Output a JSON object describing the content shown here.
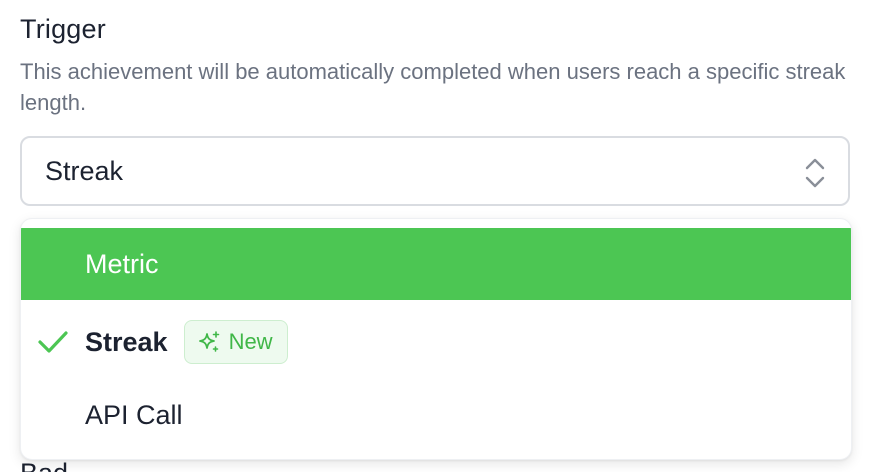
{
  "field": {
    "label": "Trigger",
    "description": "This achievement will be automatically completed when users reach a specific streak length."
  },
  "select": {
    "value": "Streak",
    "icon": "chevron-up-down-icon"
  },
  "dropdown": {
    "options": [
      {
        "label": "Metric",
        "highlighted": true,
        "selected": false
      },
      {
        "label": "Streak",
        "highlighted": false,
        "selected": true,
        "badge": {
          "label": "New",
          "icon": "sparkle-icon"
        }
      },
      {
        "label": "API Call",
        "highlighted": false,
        "selected": false
      }
    ],
    "selected_icon": "check-icon"
  },
  "next_field": {
    "label_peek": "Bad"
  },
  "colors": {
    "accent": "#4cc653",
    "badge_bg": "#eefaef",
    "badge_text": "#40b748",
    "text_primary": "#1c2230",
    "text_secondary": "#6b7280"
  }
}
